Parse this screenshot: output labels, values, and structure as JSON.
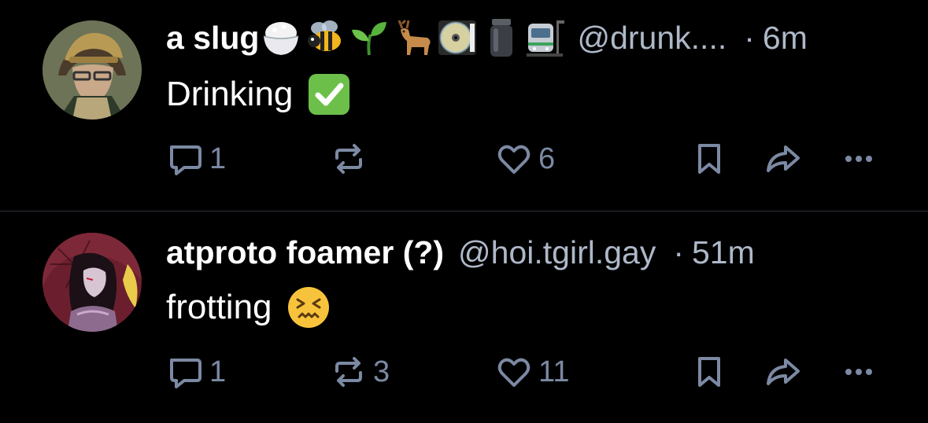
{
  "posts": [
    {
      "author_name": "a slug",
      "name_emojis": [
        "rice-bowl-icon",
        "bee-icon",
        "seedling-icon",
        "deer-icon",
        "dvd-icon",
        "jar-icon",
        "railway-car-icon"
      ],
      "handle": "@drunk....",
      "separator": "·",
      "time": "6m",
      "text": "Drinking",
      "text_emoji": "check-mark-button-icon",
      "reply_count": "1",
      "repost_count": "",
      "like_count": "6"
    },
    {
      "author_name": "atproto foamer (?)",
      "name_emojis": [],
      "handle": "@hoi.tgirl.gay",
      "separator": "·",
      "time": "51m",
      "text": "frotting",
      "text_emoji": "confounded-face-icon",
      "reply_count": "1",
      "repost_count": "3",
      "like_count": "11"
    }
  ],
  "colors": {
    "background": "#000000",
    "secondary_text": "#aeb8c8",
    "action_icon": "#7c89a3",
    "divider": "#2b3038"
  }
}
